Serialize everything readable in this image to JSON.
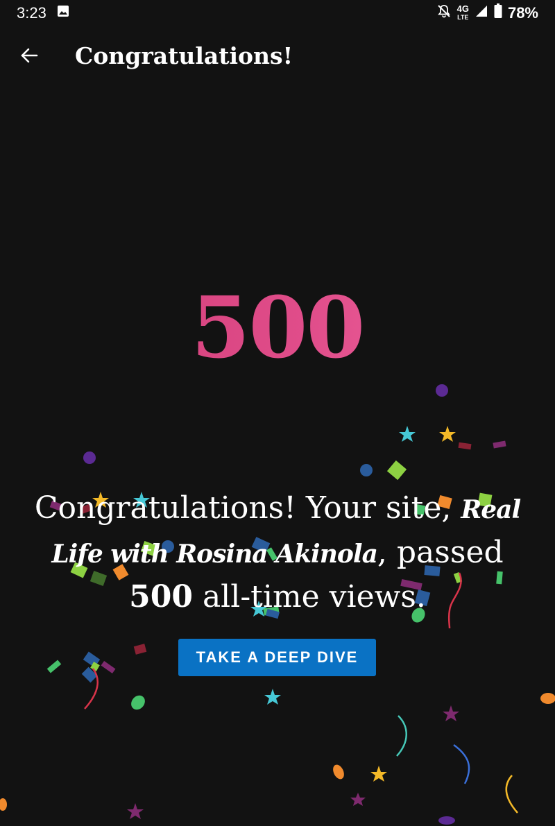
{
  "status_bar": {
    "time": "3:23",
    "network": "4G",
    "network_sub": "LTE",
    "battery": "78%",
    "icons": [
      "image-icon",
      "mute-icon",
      "signal-icon",
      "battery-icon"
    ]
  },
  "app_bar": {
    "title": "Congratulations!",
    "back_icon": "arrow-back-icon"
  },
  "milestone": {
    "value": "500"
  },
  "message": {
    "prefix": "Congratulations! Your site, ",
    "site_name": "Real Life with Rosina Akinola",
    "middle": ", passed ",
    "count": "500",
    "suffix": " all-time views."
  },
  "cta": {
    "label": "TAKE A DEEP DIVE"
  },
  "colors": {
    "background": "#121212",
    "accent_button": "#0a72c4",
    "milestone_gradient": [
      "#cf3a74",
      "#f26aa4"
    ]
  }
}
